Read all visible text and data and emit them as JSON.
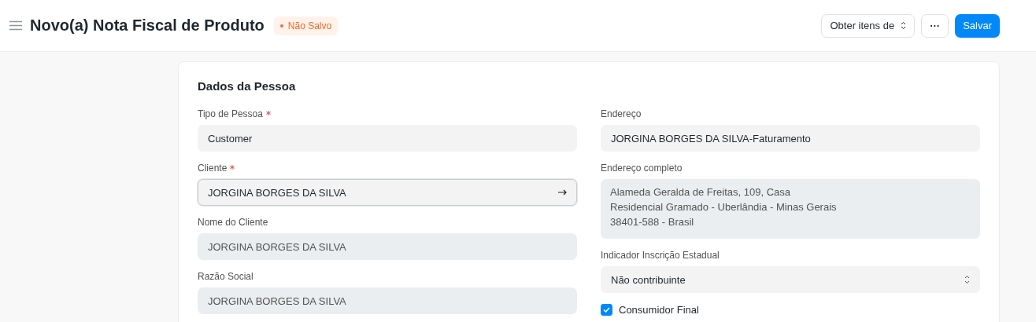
{
  "header": {
    "title": "Novo(a) Nota Fiscal de Produto",
    "status": "Não Salvo",
    "actions": [
      {
        "kind": "dropdown",
        "label": "Obter itens de"
      },
      {
        "kind": "more",
        "label": "···"
      },
      {
        "kind": "primary",
        "label": "Salvar"
      }
    ]
  },
  "section": {
    "title": "Dados da Pessoa",
    "columns": [
      [
        {
          "kind": "input",
          "label": "Tipo de Pessoa",
          "required": true,
          "value": "Customer"
        },
        {
          "kind": "link",
          "label": "Cliente",
          "required": true,
          "value": "JORGINA BORGES DA SILVA"
        },
        {
          "kind": "readonly",
          "label": "Nome do Cliente",
          "required": false,
          "value": "JORGINA BORGES DA SILVA"
        },
        {
          "kind": "readonly",
          "label": "Razão Social",
          "required": false,
          "value": "JORGINA BORGES DA SILVA"
        }
      ],
      [
        {
          "kind": "input",
          "label": "Endereço",
          "required": false,
          "value": "JORGINA BORGES DA SILVA-Faturamento"
        },
        {
          "kind": "multiline",
          "label": "Endereço completo",
          "required": false,
          "lines": [
            "Alameda Geralda de Freitas, 109, Casa",
            "Residencial Gramado - Uberlândia - Minas Gerais",
            "38401-588 - Brasil"
          ]
        },
        {
          "kind": "select",
          "label": "Indicador Inscrição Estadual",
          "required": false,
          "value": "Não contribuinte"
        },
        {
          "kind": "checkbox",
          "label": "Consumidor Final",
          "checked": true
        }
      ]
    ]
  }
}
